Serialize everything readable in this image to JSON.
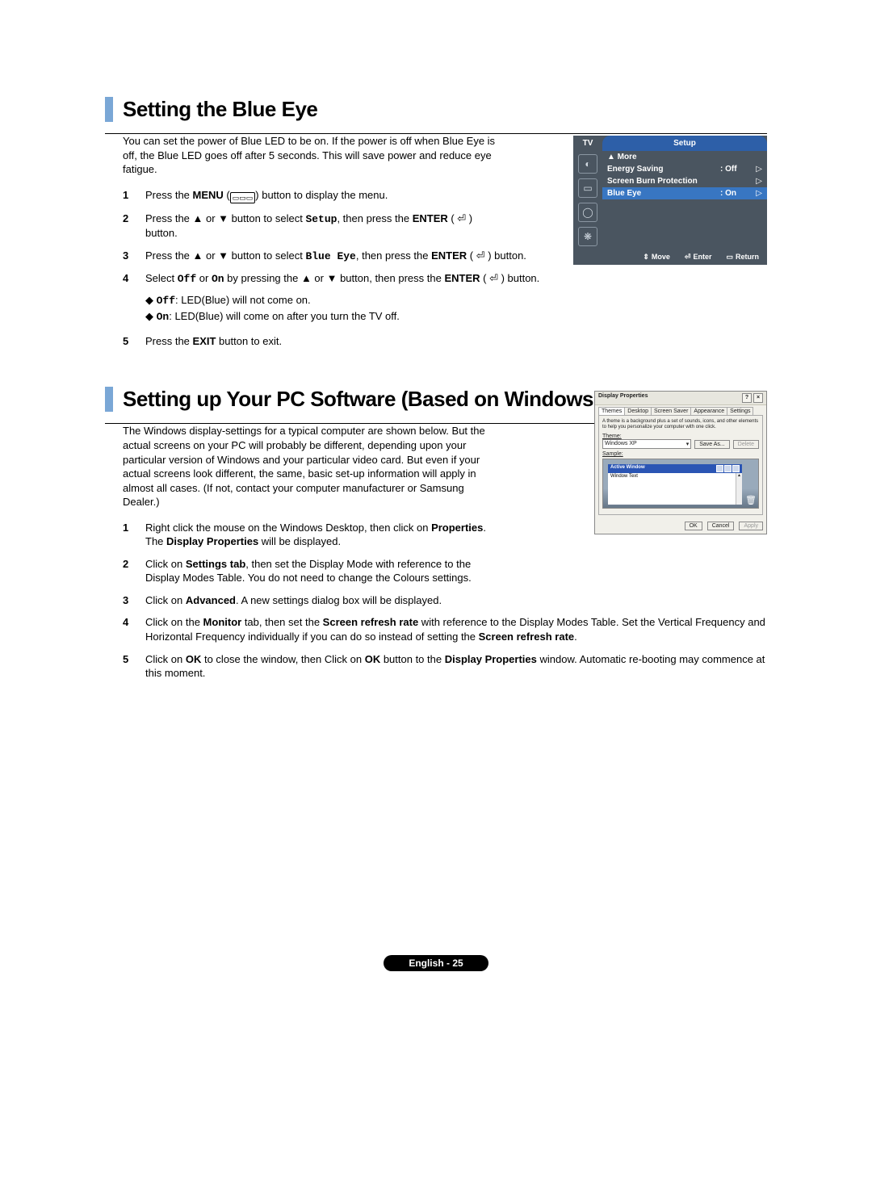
{
  "section1": {
    "title": "Setting the Blue Eye",
    "intro": "You can set the power of Blue LED to be on. If the power is off when Blue Eye is off, the Blue LED goes off after 5 seconds. This will save power and reduce eye fatigue.",
    "steps": [
      {
        "n": "1",
        "pre": "Press the ",
        "b1": "MENU",
        "mid": " (",
        "icon": "▭▭▭",
        "post": ") button to display the menu."
      },
      {
        "n": "2",
        "text": "Press the ▲ or ▼ button to select ",
        "mono": "Setup",
        "mid2": ", then press the ",
        "b2": "ENTER",
        "post2": " ( ⏎ ) button."
      },
      {
        "n": "3",
        "text": "Press the ▲ or ▼ button to select ",
        "mono": "Blue Eye",
        "mid2": ", then press the ",
        "b2": "ENTER",
        "post2": " ( ⏎ ) button."
      },
      {
        "n": "4",
        "text": "Select ",
        "mono": "Off",
        "mid": " or ",
        "mono2": "On",
        "mid2": " by pressing the ▲ or ▼ button, then press the ",
        "b2": "ENTER",
        "post2": " ( ⏎ ) button.",
        "sub": [
          {
            "m": "Off",
            "t": ": LED(Blue) will not come on."
          },
          {
            "m": "On",
            "t": ": LED(Blue) will come on after you turn the TV off."
          }
        ]
      },
      {
        "n": "5",
        "pre": "Press the ",
        "b1": "EXIT",
        "post": " button to exit."
      }
    ]
  },
  "osd": {
    "tv": "TV",
    "title": "Setup",
    "rows": [
      {
        "label": "▲ More",
        "val": "",
        "sel": false,
        "chev": ""
      },
      {
        "label": "Energy Saving",
        "val": ": Off",
        "sel": false,
        "chev": "▷"
      },
      {
        "label": "Screen Burn Protection",
        "val": "",
        "sel": false,
        "chev": "▷"
      },
      {
        "label": "Blue Eye",
        "val": ": On",
        "sel": true,
        "chev": "▷"
      }
    ],
    "footer": {
      "move": "Move",
      "enter": "Enter",
      "return": "Return"
    }
  },
  "section2": {
    "title": "Setting up Your PC Software (Based on Windows XP)",
    "intro": "The Windows display-settings for a typical computer are shown below. But the actual screens on your PC will probably be different, depending upon your particular version of Windows and your particular video card. But even if your actual screens look different, the same, basic set-up information will apply in almost all cases. (If not, contact your computer manufacturer or Samsung Dealer.)",
    "steps": [
      {
        "n": "1",
        "t1": "Right click the mouse on the Windows Desktop, then click on ",
        "b": "Properties",
        "t2": ". The ",
        "b2": "Display Properties",
        "t3": " will be displayed."
      },
      {
        "n": "2",
        "t1": "Click on ",
        "b": "Settings tab",
        "t2": ", then set the Display Mode with reference to the Display Modes Table. You do not need to change the Colours settings."
      },
      {
        "n": "3",
        "t1": "Click on ",
        "b": "Advanced",
        "t2": ". A new settings dialog box will be displayed."
      },
      {
        "n": "4",
        "t1": "Click on the ",
        "b": "Monitor",
        "t2": " tab, then set the ",
        "b2": "Screen refresh rate",
        "t3": " with reference to the Display Modes Table. Set the Vertical Frequency and Horizontal Frequency individually if you can do so instead of setting the ",
        "b3": "Screen refresh rate",
        "t4": "."
      },
      {
        "n": "5",
        "t1": "Click on ",
        "b": "OK",
        "t2": " to close the window, then Click on ",
        "b2": "OK",
        "t3": " button to the ",
        "b3": "Display Properties",
        "t4": " window. Automatic re-booting may commence at this moment."
      }
    ]
  },
  "xp": {
    "title": "Display Properties",
    "tabs": [
      "Themes",
      "Desktop",
      "Screen Saver",
      "Appearance",
      "Settings"
    ],
    "desc": "A theme is a background plus a set of sounds, icons, and other elements to help you personalize your computer with one click.",
    "theme_lbl": "Theme:",
    "theme_val": "Windows XP",
    "save": "Save As...",
    "delete": "Delete",
    "sample_lbl": "Sample:",
    "aw": "Active Window",
    "wt": "Window Text",
    "ok": "OK",
    "cancel": "Cancel",
    "apply": "Apply"
  },
  "pagenum": "English - 25"
}
